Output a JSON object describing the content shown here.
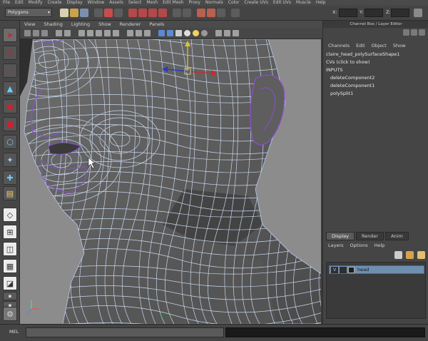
{
  "menubar": {
    "items": [
      "File",
      "Edit",
      "Modify",
      "Create",
      "Display",
      "Window",
      "Assets",
      "Select",
      "Mesh",
      "Edit Mesh",
      "Proxy",
      "Normals",
      "Color",
      "Create UVs",
      "Edit UVs",
      "Muscle",
      "Help"
    ]
  },
  "statusline": {
    "mode": "Polygons",
    "field_labels": [
      "X:",
      "Y:",
      "Z:"
    ]
  },
  "viewport": {
    "menu": [
      "View",
      "Shading",
      "Lighting",
      "Show",
      "Renderer",
      "Panels"
    ],
    "mesh_color": "#c9d8f0",
    "selection_color": "#8a4fd0",
    "background_color": "#8c8c8c"
  },
  "channelbox": {
    "header": "Channel Box / Layer Editor",
    "menu": [
      "Channels",
      "Edit",
      "Object",
      "Show"
    ],
    "object_name": "claire_head_polySurfaceShape1",
    "cvs": "CVs (click to show)",
    "inputs_label": "INPUTS",
    "inputs": [
      "deleteComponent2",
      "deleteComponent1",
      "polySplit1"
    ]
  },
  "layer_editor": {
    "tabs": [
      "Display",
      "Render",
      "Anim"
    ],
    "menu": [
      "Layers",
      "Options",
      "Help"
    ],
    "layers": [
      {
        "visible": "V",
        "name": "head"
      }
    ],
    "row_color": "#6f8fb0"
  },
  "cmdline": {
    "label": "MEL"
  }
}
